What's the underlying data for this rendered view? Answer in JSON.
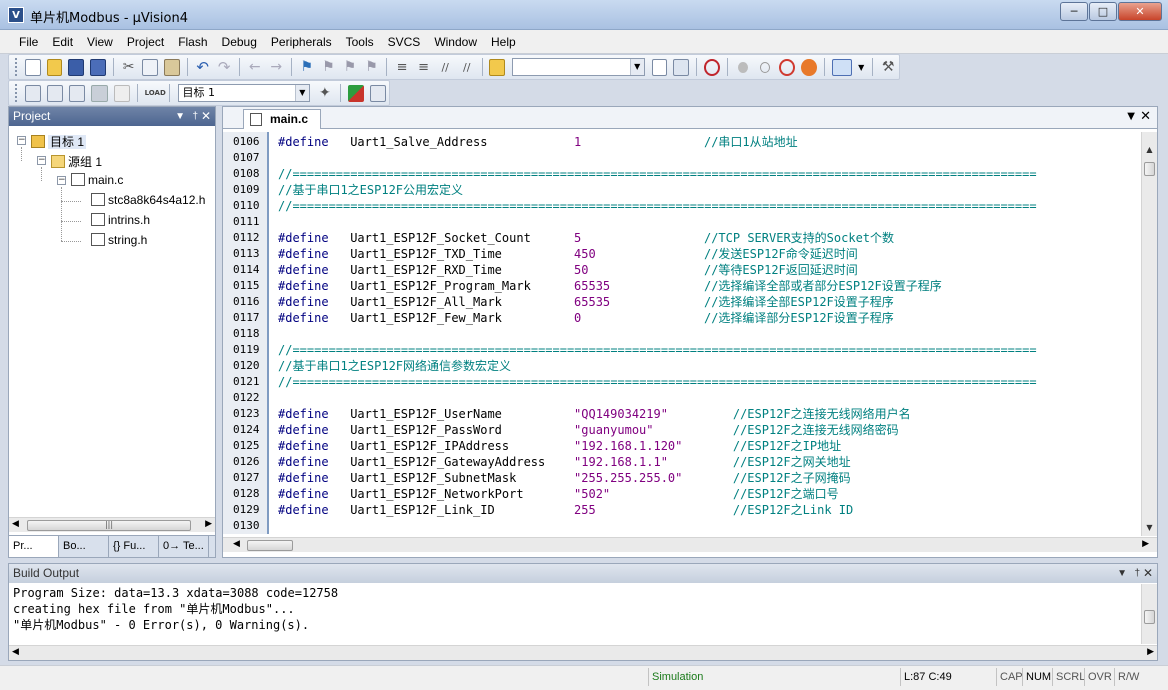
{
  "window": {
    "title": "单片机Modbus - µVision4",
    "app_icon_letter": "V"
  },
  "menu": [
    "File",
    "Edit",
    "View",
    "Project",
    "Flash",
    "Debug",
    "Peripherals",
    "Tools",
    "SVCS",
    "Window",
    "Help"
  ],
  "toolbar2": {
    "target_combo": "目标 1"
  },
  "project": {
    "header": "Project",
    "tree": {
      "target": "目标 1",
      "group": "源组 1",
      "file": "main.c",
      "includes": [
        "stc8a8k64s4a12.h",
        "intrins.h",
        "string.h"
      ]
    },
    "bottom_tabs": [
      "Pr...",
      "Bo...",
      "{} Fu...",
      "0→ Te..."
    ]
  },
  "editor": {
    "tab_label": "main.c",
    "lines": [
      {
        "n": "0106",
        "kw": "#define",
        "id": "Uart1_Salve_Address",
        "val": "1",
        "vt": "num",
        "cmt": "//串口1从站地址",
        "cc": 59
      },
      {
        "n": "0107"
      },
      {
        "n": "0108",
        "cmt": "//=======================================================================================================",
        "cc": 0
      },
      {
        "n": "0109",
        "cmt": "//基于串口1之ESP12F公用宏定义",
        "cc": 0
      },
      {
        "n": "0110",
        "cmt": "//=======================================================================================================",
        "cc": 0
      },
      {
        "n": "0111"
      },
      {
        "n": "0112",
        "kw": "#define",
        "id": "Uart1_ESP12F_Socket_Count",
        "val": "5",
        "vt": "num",
        "cmt": "//TCP SERVER支持的Socket个数",
        "cc": 59
      },
      {
        "n": "0113",
        "kw": "#define",
        "id": "Uart1_ESP12F_TXD_Time",
        "val": "450",
        "vt": "num",
        "cmt": "//发送ESP12F命令延迟时间",
        "cc": 59
      },
      {
        "n": "0114",
        "kw": "#define",
        "id": "Uart1_ESP12F_RXD_Time",
        "val": "50",
        "vt": "num",
        "cmt": "//等待ESP12F返回延迟时间",
        "cc": 59
      },
      {
        "n": "0115",
        "kw": "#define",
        "id": "Uart1_ESP12F_Program_Mark",
        "val": "65535",
        "vt": "num",
        "cmt": "//选择编译全部或者部分ESP12F设置子程序",
        "cc": 59
      },
      {
        "n": "0116",
        "kw": "#define",
        "id": "Uart1_ESP12F_All_Mark",
        "val": "65535",
        "vt": "num",
        "cmt": "//选择编译全部ESP12F设置子程序",
        "cc": 59
      },
      {
        "n": "0117",
        "kw": "#define",
        "id": "Uart1_ESP12F_Few_Mark",
        "val": "0",
        "vt": "num",
        "cmt": "//选择编译部分ESP12F设置子程序",
        "cc": 59
      },
      {
        "n": "0118"
      },
      {
        "n": "0119",
        "cmt": "//=======================================================================================================",
        "cc": 0
      },
      {
        "n": "0120",
        "cmt": "//基于串口1之ESP12F网络通信参数宏定义",
        "cc": 0
      },
      {
        "n": "0121",
        "cmt": "//=======================================================================================================",
        "cc": 0
      },
      {
        "n": "0122"
      },
      {
        "n": "0123",
        "kw": "#define",
        "id": "Uart1_ESP12F_UserName",
        "val": "\"QQ149034219\"",
        "vt": "str",
        "cmt": "//ESP12F之连接无线网络用户名",
        "cc": 63
      },
      {
        "n": "0124",
        "kw": "#define",
        "id": "Uart1_ESP12F_PassWord",
        "val": "\"guanyumou\"",
        "vt": "str",
        "cmt": "//ESP12F之连接无线网络密码",
        "cc": 63
      },
      {
        "n": "0125",
        "kw": "#define",
        "id": "Uart1_ESP12F_IPAddress",
        "val": "\"192.168.1.120\"",
        "vt": "str",
        "cmt": "//ESP12F之IP地址",
        "cc": 63
      },
      {
        "n": "0126",
        "kw": "#define",
        "id": "Uart1_ESP12F_GatewayAddress",
        "val": "\"192.168.1.1\"",
        "vt": "str",
        "cmt": "//ESP12F之网关地址",
        "cc": 63
      },
      {
        "n": "0127",
        "kw": "#define",
        "id": "Uart1_ESP12F_SubnetMask",
        "val": "\"255.255.255.0\"",
        "vt": "str",
        "cmt": "//ESP12F之子网掩码",
        "cc": 63
      },
      {
        "n": "0128",
        "kw": "#define",
        "id": "Uart1_ESP12F_NetworkPort",
        "val": "\"502\"",
        "vt": "str",
        "cmt": "//ESP12F之端口号",
        "cc": 63
      },
      {
        "n": "0129",
        "kw": "#define",
        "id": "Uart1_ESP12F_Link_ID",
        "val": "255",
        "vt": "num",
        "cmt": "//ESP12F之Link ID",
        "cc": 63
      },
      {
        "n": "0130"
      }
    ]
  },
  "build_output": {
    "header": "Build Output",
    "lines": [
      "Program Size: data=13.3 xdata=3088 code=12758",
      "creating hex file from \"单片机Modbus\"...",
      "\"单片机Modbus\" - 0 Error(s), 0 Warning(s)."
    ]
  },
  "status": {
    "mode": "Simulation",
    "position": "L:87 C:49",
    "indicators": [
      "CAP",
      "NUM",
      "SCRL",
      "OVR",
      "R/W"
    ]
  },
  "colors": {
    "keyword": "#000080",
    "number": "#800080",
    "comment": "#008080",
    "title_bar": "#a9c1e2"
  }
}
